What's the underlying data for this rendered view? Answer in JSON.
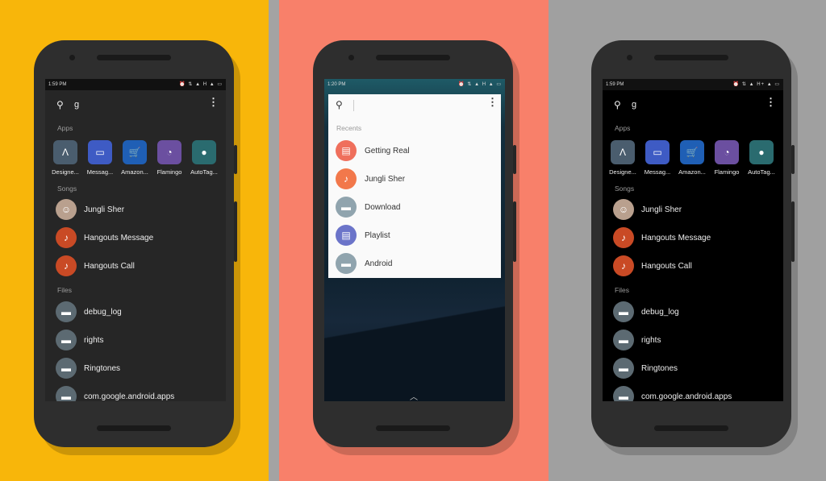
{
  "colors": {
    "panel_left": "#F8B60A",
    "panel_middle": "#F8806A",
    "panel_right": "#A0A0A0",
    "divider": "#A3A3A3",
    "song_icon": "#C94A25",
    "folder_icon": "#5C6A72"
  },
  "phones": [
    {
      "theme": "dark",
      "time": "1:59 PM",
      "status_icons": "⏰ ⇅ ▲ H ▲ ▭",
      "query": "g",
      "apps_label": "Apps",
      "apps": [
        {
          "label": "Designe...",
          "icon": "designer-icon",
          "color": "#4a5d6e"
        },
        {
          "label": "Messag...",
          "icon": "messages-icon",
          "color": "#3e5bc4"
        },
        {
          "label": "Amazon...",
          "icon": "amazon-icon",
          "color": "#1f5fb5"
        },
        {
          "label": "Flamingo",
          "icon": "flamingo-icon",
          "color": "#6b4fa0"
        },
        {
          "label": "AutoTag...",
          "icon": "autotag-icon",
          "color": "#2a6b6f"
        }
      ],
      "songs_label": "Songs",
      "songs": [
        {
          "label": "Jungli Sher",
          "icon": "album-art-icon"
        },
        {
          "label": "Hangouts Message",
          "icon": "music-note-icon"
        },
        {
          "label": "Hangouts Call",
          "icon": "music-note-icon"
        }
      ],
      "files_label": "Files",
      "files": [
        {
          "label": "debug_log"
        },
        {
          "label": "rights"
        },
        {
          "label": "Ringtones"
        },
        {
          "label": "com.google.android.apps"
        }
      ]
    },
    {
      "theme": "light",
      "time": "1:20 PM",
      "status_icons": "⏰ ⇅ ▲ H ▲ ▭",
      "query": "",
      "recents_label": "Recents",
      "recents": [
        {
          "label": "Getting Real",
          "icon": "pdf-icon",
          "color": "#EF6F5C"
        },
        {
          "label": "Jungli Sher",
          "icon": "music-note-icon",
          "color": "#F2784B"
        },
        {
          "label": "Download",
          "icon": "folder-icon",
          "color": "#90A4AE"
        },
        {
          "label": "Playlist",
          "icon": "document-icon",
          "color": "#6B74C9"
        },
        {
          "label": "Android",
          "icon": "folder-icon",
          "color": "#90A4AE"
        }
      ]
    },
    {
      "theme": "black",
      "time": "1:59 PM",
      "status_icons": "⏰ ⇅ ▲ H+ ▲ ▭",
      "query": "g",
      "apps_label": "Apps",
      "apps": [
        {
          "label": "Designe...",
          "icon": "designer-icon",
          "color": "#4a5d6e"
        },
        {
          "label": "Messag...",
          "icon": "messages-icon",
          "color": "#3e5bc4"
        },
        {
          "label": "Amazon...",
          "icon": "amazon-icon",
          "color": "#1f5fb5"
        },
        {
          "label": "Flamingo",
          "icon": "flamingo-icon",
          "color": "#6b4fa0"
        },
        {
          "label": "AutoTag...",
          "icon": "autotag-icon",
          "color": "#2a6b6f"
        }
      ],
      "songs_label": "Songs",
      "songs": [
        {
          "label": "Jungli Sher",
          "icon": "album-art-icon"
        },
        {
          "label": "Hangouts Message",
          "icon": "music-note-icon"
        },
        {
          "label": "Hangouts Call",
          "icon": "music-note-icon"
        }
      ],
      "files_label": "Files",
      "files": [
        {
          "label": "debug_log"
        },
        {
          "label": "rights"
        },
        {
          "label": "Ringtones"
        },
        {
          "label": "com.google.android.apps"
        }
      ]
    }
  ]
}
